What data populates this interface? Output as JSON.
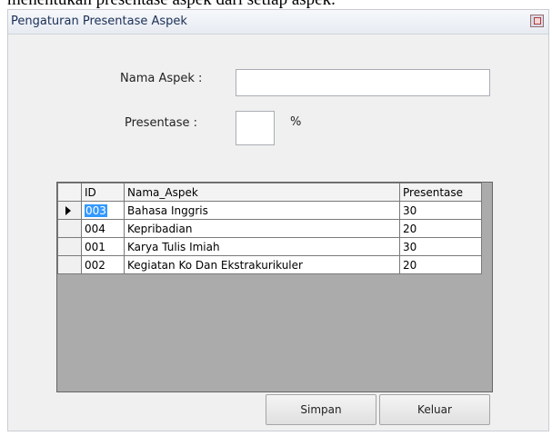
{
  "page_caption": "menentukan presentase aspek dari setiap aspek.",
  "window": {
    "title": "Pengaturan Presentase Aspek"
  },
  "form": {
    "nama_aspek_label": "Nama Aspek :",
    "nama_aspek_value": "",
    "presentase_label": "Presentase :",
    "presentase_value": "",
    "percent_unit": "%"
  },
  "grid": {
    "headers": [
      "ID",
      "Nama_Aspek",
      "Presentase"
    ],
    "rows": [
      {
        "id": "003",
        "nama": "Bahasa Inggris",
        "presentase": "30",
        "selected": true
      },
      {
        "id": "004",
        "nama": "Kepribadian",
        "presentase": "20",
        "selected": false
      },
      {
        "id": "001",
        "nama": "Karya Tulis Imiah",
        "presentase": "30",
        "selected": false
      },
      {
        "id": "002",
        "nama": "Kegiatan Ko Dan Ekstrakurikuler",
        "presentase": "20",
        "selected": false
      }
    ]
  },
  "buttons": {
    "simpan": "Simpan",
    "keluar": "Keluar"
  }
}
